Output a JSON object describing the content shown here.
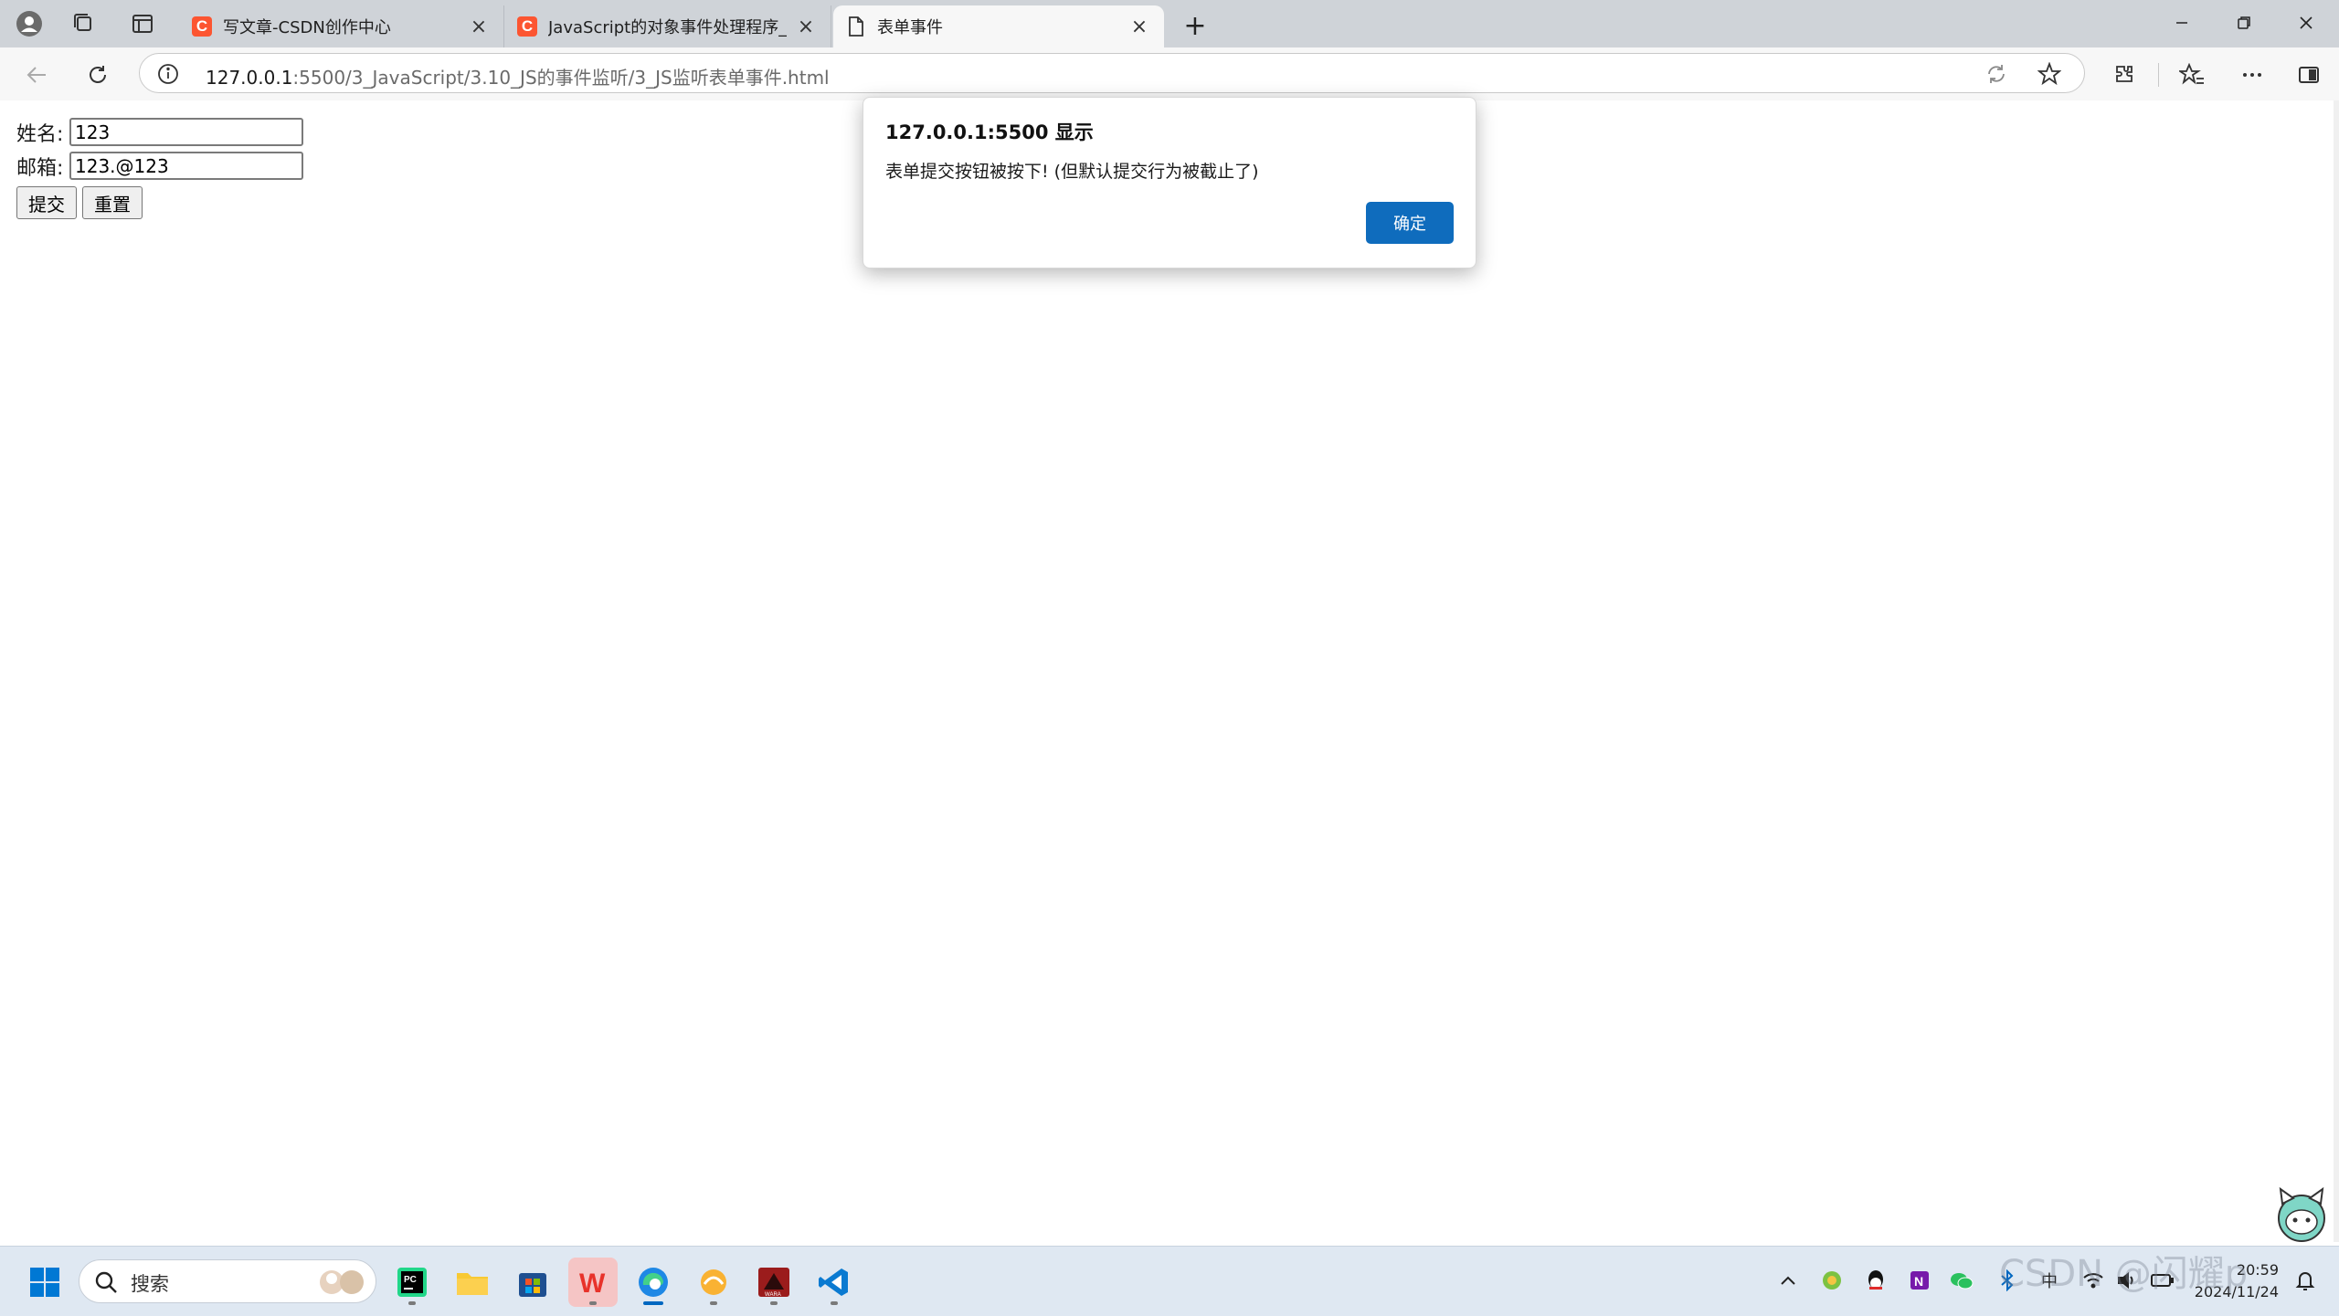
{
  "tabs": [
    {
      "title": "写文章-CSDN创作中心",
      "favicon": "csdn-icon"
    },
    {
      "title": "JavaScript的对象事件处理程序_se",
      "favicon": "csdn-icon"
    },
    {
      "title": "表单事件",
      "favicon": "page-icon"
    }
  ],
  "tab_close": "×",
  "newtab": "+",
  "address": {
    "host": "127.0.0.1",
    "path": ":5500/3_JavaScript/3.10_JS的事件监听/3_JS监听表单事件.html"
  },
  "form": {
    "name_label": "姓名:",
    "name_value": "123",
    "email_label": "邮箱:",
    "email_value": "123.@123",
    "submit_label": "提交",
    "reset_label": "重置"
  },
  "alert": {
    "title": "127.0.0.1:5500 显示",
    "message": "表单提交按钮被按下! (但默认提交行为被截止了)",
    "ok_label": "确定"
  },
  "taskbar": {
    "search_placeholder": "搜索",
    "apps": [
      "start-icon",
      "pycharm-icon",
      "file-explorer-icon",
      "store-icon",
      "wps-icon",
      "edge-icon",
      "sublime-icon",
      "game-icon",
      "vscode-icon"
    ]
  },
  "tray": {
    "lang": "中",
    "time": "20:59",
    "date": "2024/11/24"
  },
  "watermark": "CSDN @闪耀p",
  "colors": {
    "accent": "#0f6cbd",
    "csdn": "#fc5531",
    "tabstrip": "#cfd3d8",
    "taskbar": "#dfe8f2"
  }
}
